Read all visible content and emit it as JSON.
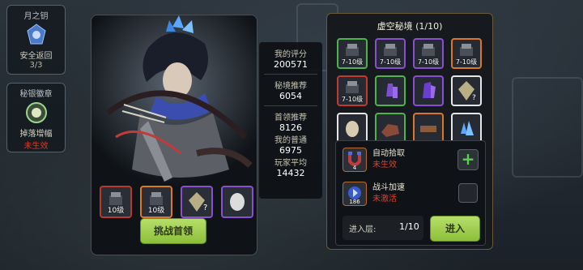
{
  "left_buttons": [
    {
      "title": "月之钥",
      "sub": "安全返回",
      "sub2": "3/3"
    },
    {
      "title": "秘银徽章",
      "sub": "掉落增幅",
      "status": "未生效"
    }
  ],
  "hero_panel": {
    "rewards": [
      {
        "label": "10级",
        "rarity": "red"
      },
      {
        "label": "10级",
        "rarity": "orange"
      },
      {
        "label": "",
        "rarity": "purple"
      },
      {
        "label": "",
        "rarity": "purple"
      }
    ],
    "challenge_button": "挑战首领"
  },
  "stats": {
    "my_score_label": "我的评分",
    "my_score": "200571",
    "recommend_label": "秘境推荐",
    "recommend": "6054",
    "boss_recommend_label": "首领推荐",
    "boss_recommend": "8126",
    "my_normal_label": "我的普通",
    "my_normal": "6975",
    "player_avg_label": "玩家平均",
    "player_avg": "14432"
  },
  "right_panel": {
    "title": "虚空秘境 (1/10)",
    "grid": [
      {
        "label": "7-10级",
        "rarity": "green"
      },
      {
        "label": "7-10级",
        "rarity": "purple"
      },
      {
        "label": "7-10级",
        "rarity": "purple"
      },
      {
        "label": "7-10级",
        "rarity": "orange"
      },
      {
        "label": "7-10级",
        "rarity": "red"
      },
      {
        "label": "",
        "rarity": "green"
      },
      {
        "label": "",
        "rarity": "purple"
      },
      {
        "label": "",
        "rarity": "white"
      },
      {
        "label": "",
        "rarity": "white"
      },
      {
        "label": "",
        "rarity": "green"
      },
      {
        "label": "",
        "rarity": "orange"
      },
      {
        "label": "",
        "rarity": "white"
      }
    ],
    "auto_pickup": {
      "title": "自动拾取",
      "status": "未生效",
      "icon_label": "4"
    },
    "battle_speed": {
      "title": "战斗加速",
      "status": "未激活",
      "icon_label": "186"
    },
    "floor_label": "进入层:",
    "floor_value": "1/10",
    "enter_button": "进入"
  },
  "colors": {
    "accent_green": "#9fd050",
    "status_red": "#d8432f",
    "rarity_green": "#4fb24a",
    "rarity_purple": "#8a4fd0",
    "rarity_orange": "#d9782a",
    "rarity_red": "#c23a2a"
  }
}
